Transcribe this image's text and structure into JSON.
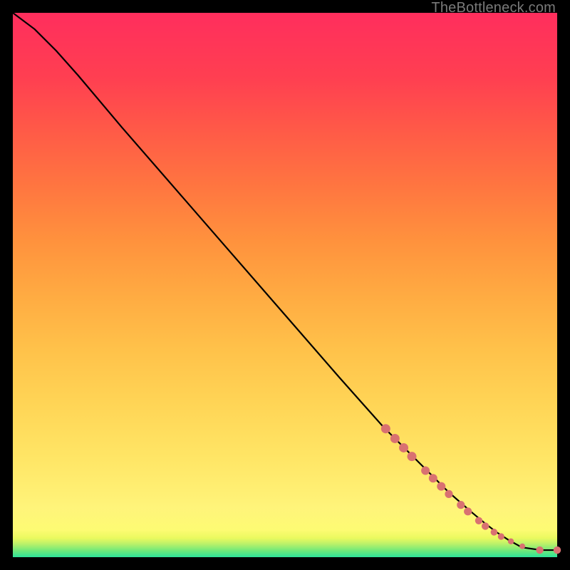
{
  "watermark": "TheBottleneck.com",
  "colors": {
    "marker": "#d97171",
    "curve": "#000000"
  },
  "chart_data": {
    "type": "line",
    "title": "",
    "xlabel": "",
    "ylabel": "",
    "xlim": [
      0,
      100
    ],
    "ylim": [
      0,
      100
    ],
    "grid": false,
    "series": [
      {
        "name": "bottleneck-curve",
        "x": [
          0,
          4,
          8,
          12,
          20,
          30,
          40,
          50,
          60,
          68,
          72,
          76,
          80,
          84,
          87,
          89,
          91,
          93.5,
          97,
          100
        ],
        "y": [
          100,
          97,
          93,
          88.5,
          79,
          67.5,
          56,
          44.5,
          33,
          24,
          20,
          16,
          12,
          8.5,
          6,
          4.5,
          3.2,
          1.8,
          1.3,
          1.3
        ]
      }
    ],
    "markers": [
      {
        "x": 68.5,
        "y": 23.6,
        "r": 6.5
      },
      {
        "x": 70.2,
        "y": 21.8,
        "r": 6.5
      },
      {
        "x": 71.8,
        "y": 20.1,
        "r": 6.5
      },
      {
        "x": 73.3,
        "y": 18.5,
        "r": 6.5
      },
      {
        "x": 75.8,
        "y": 15.9,
        "r": 6.0
      },
      {
        "x": 77.2,
        "y": 14.5,
        "r": 6.0
      },
      {
        "x": 78.7,
        "y": 13.0,
        "r": 6.0
      },
      {
        "x": 80.1,
        "y": 11.6,
        "r": 5.6
      },
      {
        "x": 82.3,
        "y": 9.6,
        "r": 5.6
      },
      {
        "x": 83.6,
        "y": 8.4,
        "r": 5.6
      },
      {
        "x": 85.6,
        "y": 6.7,
        "r": 5.2
      },
      {
        "x": 86.8,
        "y": 5.7,
        "r": 5.2
      },
      {
        "x": 88.4,
        "y": 4.6,
        "r": 4.8
      },
      {
        "x": 89.7,
        "y": 3.8,
        "r": 4.6
      },
      {
        "x": 91.5,
        "y": 2.9,
        "r": 4.2
      },
      {
        "x": 93.6,
        "y": 2.0,
        "r": 4.0
      },
      {
        "x": 96.8,
        "y": 1.3,
        "r": 5.2
      },
      {
        "x": 100.0,
        "y": 1.3,
        "r": 5.2
      }
    ]
  }
}
